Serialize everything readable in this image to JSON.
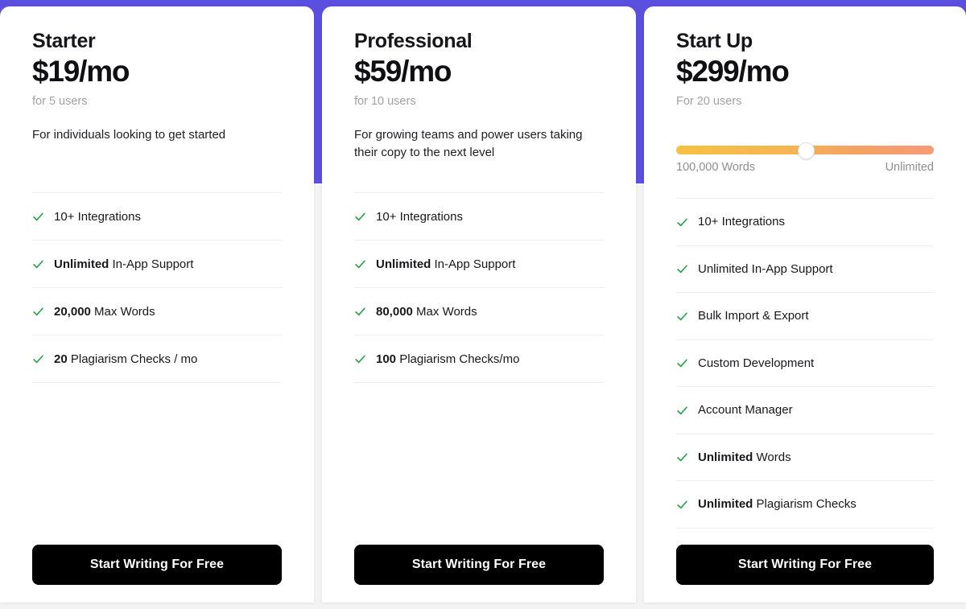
{
  "theme": {
    "banner_color": "#5b4fe0",
    "page_background": "#f3f3f4",
    "card_background": "#ffffff",
    "check_color": "#22a04a",
    "cta_background": "#000000",
    "cta_text_color": "#ffffff",
    "slider_gradient_start": "#f7c143",
    "slider_gradient_end": "#f59b7a"
  },
  "plans": [
    {
      "id": "starter",
      "name": "Starter",
      "price": "$19/mo",
      "users": "for 5 users",
      "description": "For individuals looking to get started",
      "cta_label": "Start Writing For Free",
      "features": [
        {
          "bold": "",
          "text": "10+ Integrations"
        },
        {
          "bold": "Unlimited",
          "text": " In-App Support"
        },
        {
          "bold": "20,000",
          "text": " Max Words"
        },
        {
          "bold": "20",
          "text": " Plagiarism Checks / mo"
        }
      ]
    },
    {
      "id": "professional",
      "name": "Professional",
      "price": "$59/mo",
      "users": "for 10 users",
      "description": "For growing teams and power users taking their copy to the next level",
      "cta_label": "Start Writing For Free",
      "features": [
        {
          "bold": "",
          "text": "10+ Integrations"
        },
        {
          "bold": "Unlimited",
          "text": " In-App Support"
        },
        {
          "bold": "80,000",
          "text": " Max Words"
        },
        {
          "bold": "100",
          "text": " Plagiarism Checks/mo"
        }
      ]
    },
    {
      "id": "startup",
      "name": "Start Up",
      "price": "$299/mo",
      "users": "For 20 users",
      "description": "",
      "cta_label": "Start Writing For Free",
      "slider": {
        "min_label": "100,000 Words",
        "max_label": "Unlimited",
        "value_percent": 50
      },
      "features": [
        {
          "bold": "",
          "text": "10+ Integrations"
        },
        {
          "bold": "",
          "text": "Unlimited In-App Support"
        },
        {
          "bold": "",
          "text": "Bulk Import & Export"
        },
        {
          "bold": "",
          "text": "Custom Development"
        },
        {
          "bold": "",
          "text": "Account Manager"
        },
        {
          "bold": "Unlimited",
          "text": " Words"
        },
        {
          "bold": "Unlimited",
          "text": " Plagiarism Checks"
        }
      ]
    }
  ]
}
